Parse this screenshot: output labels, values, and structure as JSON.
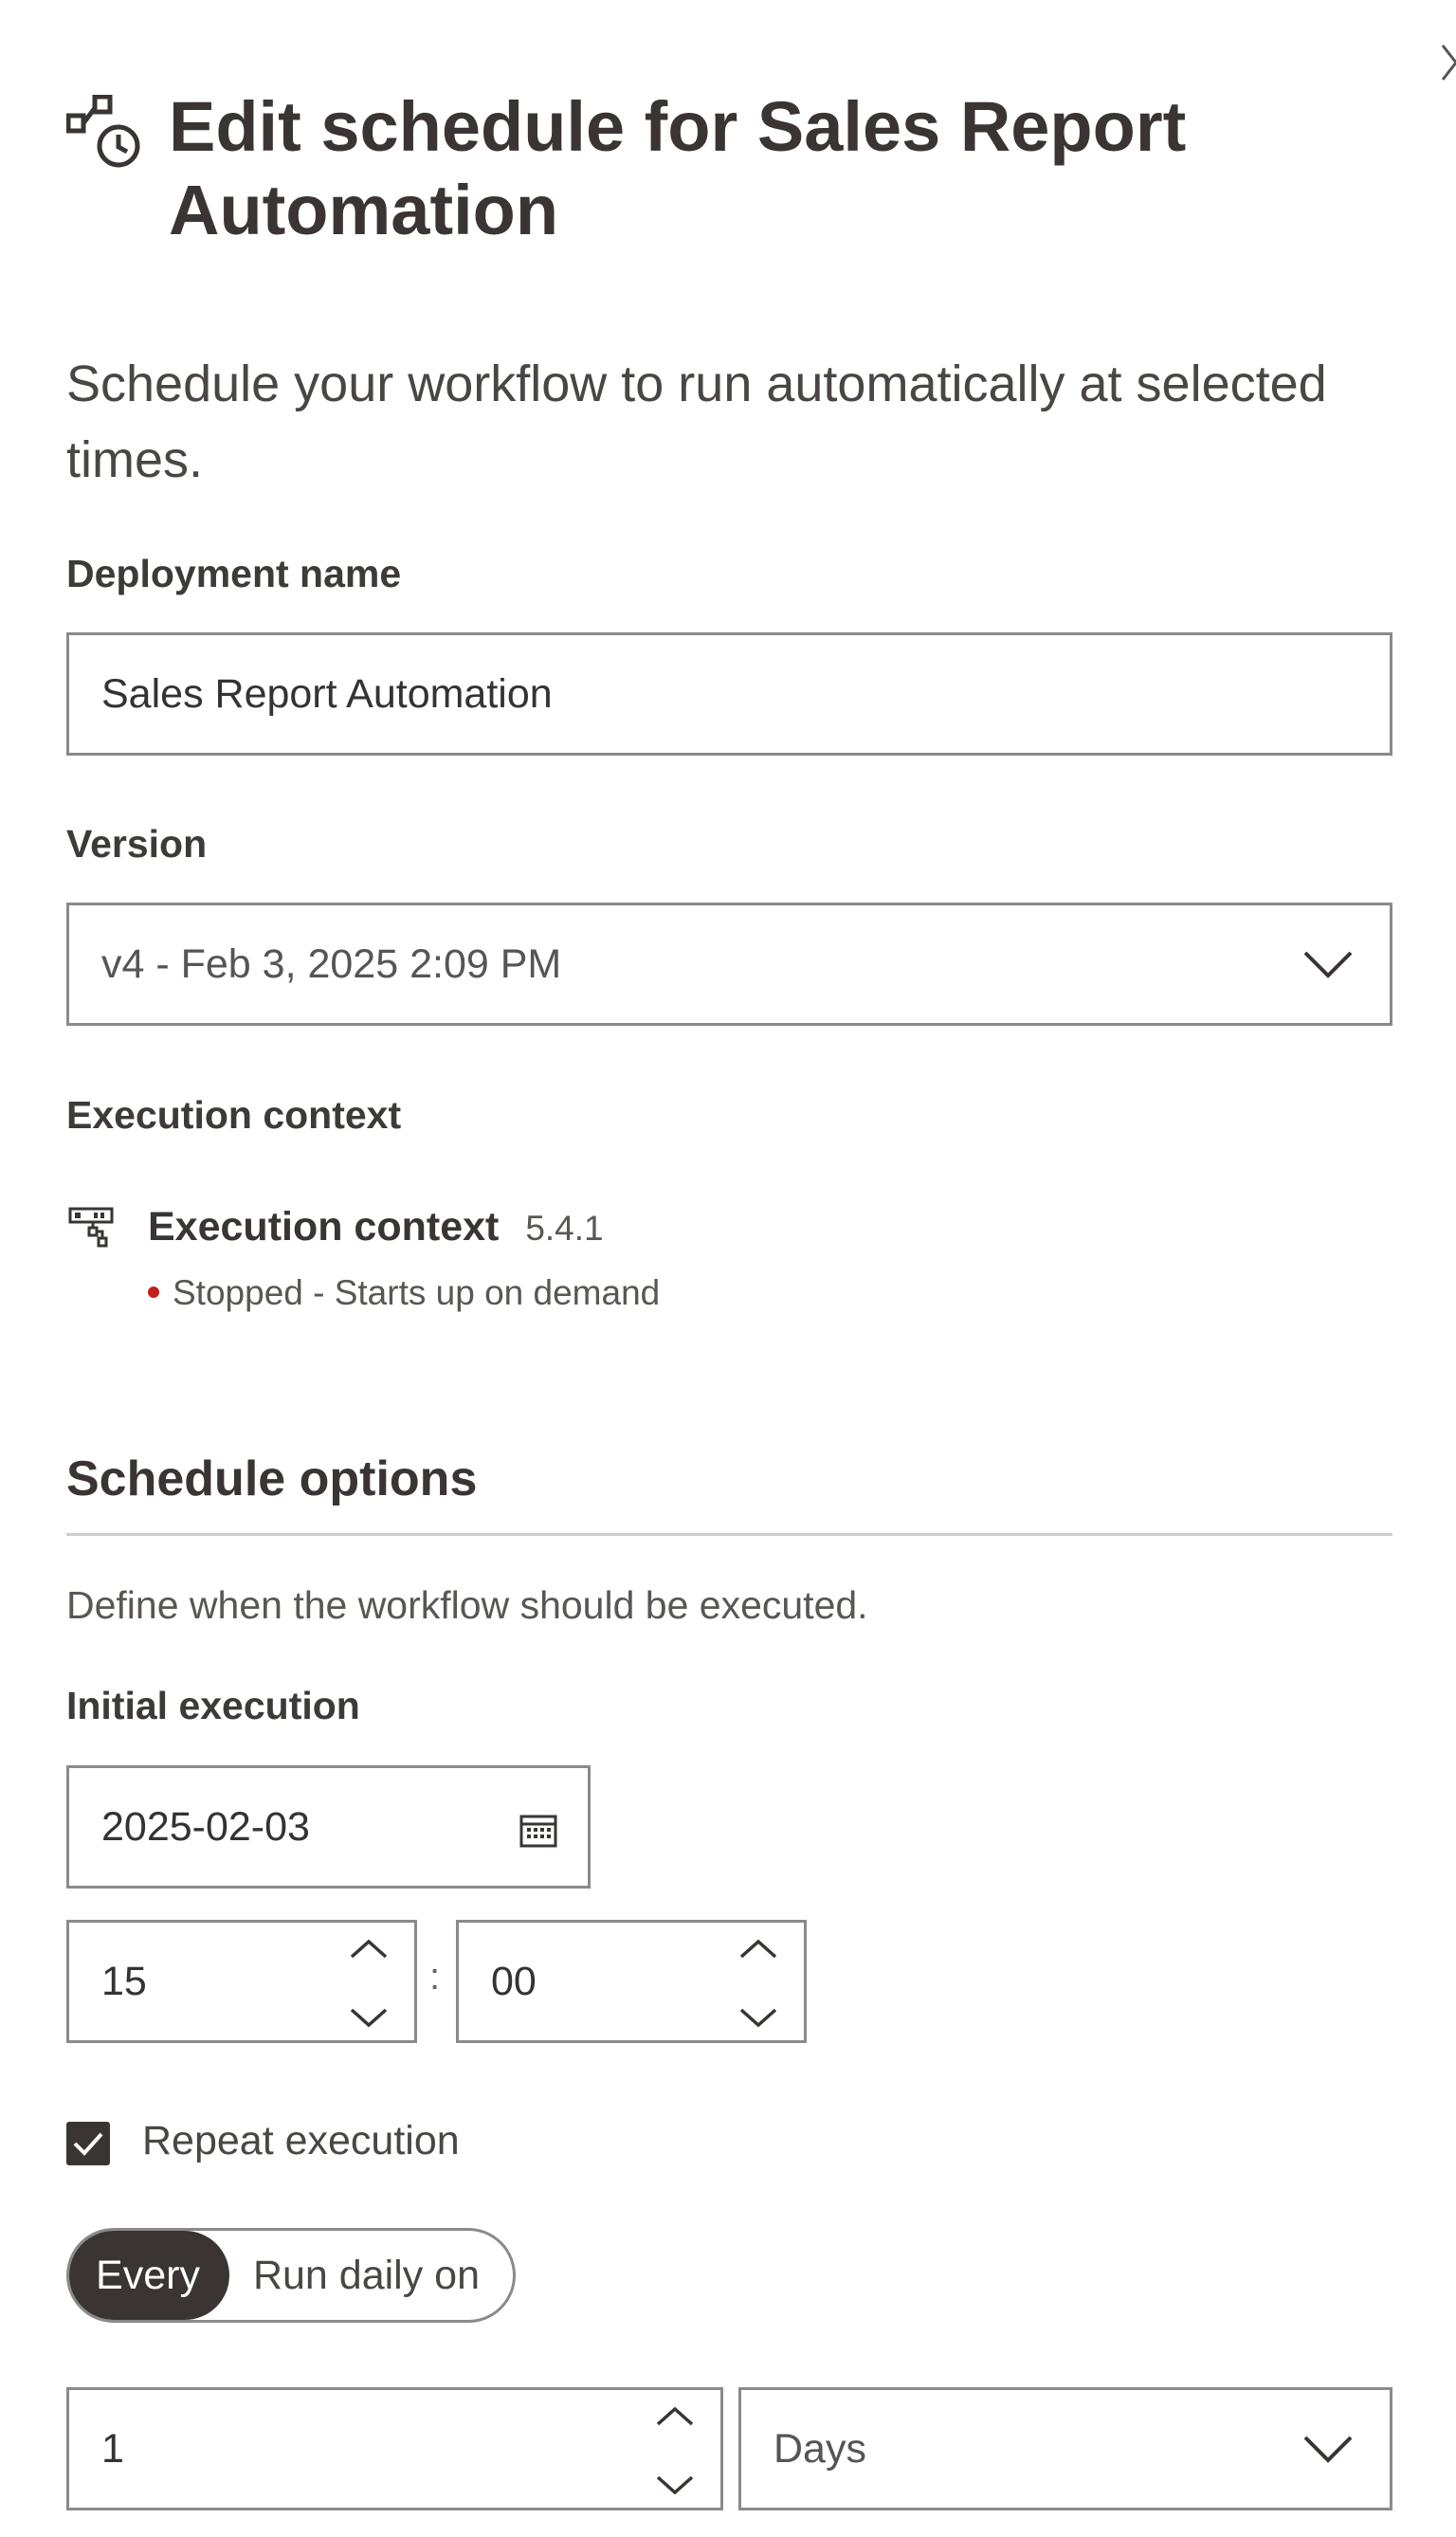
{
  "header": {
    "title": "Edit schedule for Sales Report Automation",
    "icon": "workflow-schedule-icon",
    "close_icon": "close-icon"
  },
  "intro": "Schedule your workflow to run automatically at selected times.",
  "deployment": {
    "label": "Deployment name",
    "value": "Sales Report Automation"
  },
  "version": {
    "label": "Version",
    "value": "v4 - Feb 3, 2025 2:09 PM"
  },
  "execution_context": {
    "label": "Execution context",
    "name": "Execution context",
    "version": "5.4.1",
    "status": "Stopped - Starts up on demand",
    "status_color": "#c41e1e",
    "icon": "execution-context-icon"
  },
  "schedule": {
    "title": "Schedule options",
    "description": "Define when the workflow should be executed.",
    "initial_label": "Initial execution",
    "date": "2025-02-03",
    "hour": "15",
    "separator": ":",
    "minute": "00",
    "repeat_label": "Repeat execution",
    "repeat_checked": true,
    "mode_options": [
      "Every",
      "Run daily on"
    ],
    "mode_selected": "Every",
    "interval_value": "1",
    "interval_unit": "Days"
  },
  "colors": {
    "dark": "#3a3533",
    "border": "#8c8a88",
    "divider": "#cfcdcb"
  }
}
